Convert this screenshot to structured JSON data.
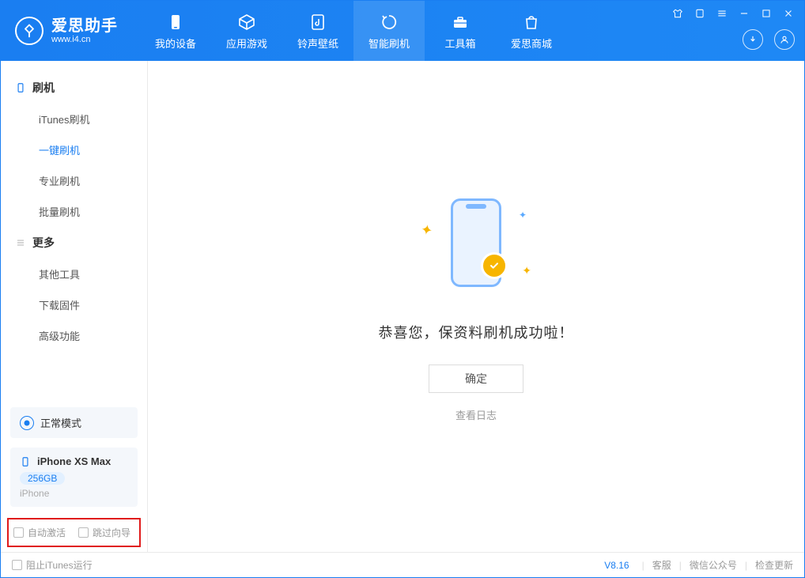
{
  "app": {
    "title": "爱思助手",
    "subtitle": "www.i4.cn"
  },
  "nav": {
    "items": [
      {
        "label": "我的设备"
      },
      {
        "label": "应用游戏"
      },
      {
        "label": "铃声壁纸"
      },
      {
        "label": "智能刷机"
      },
      {
        "label": "工具箱"
      },
      {
        "label": "爱思商城"
      }
    ]
  },
  "sidebar": {
    "section_flash": "刷机",
    "items_flash": [
      {
        "label": "iTunes刷机"
      },
      {
        "label": "一键刷机"
      },
      {
        "label": "专业刷机"
      },
      {
        "label": "批量刷机"
      }
    ],
    "section_more": "更多",
    "items_more": [
      {
        "label": "其他工具"
      },
      {
        "label": "下载固件"
      },
      {
        "label": "高级功能"
      }
    ]
  },
  "mode": {
    "label": "正常模式"
  },
  "device": {
    "name": "iPhone XS Max",
    "capacity": "256GB",
    "type": "iPhone"
  },
  "options": {
    "auto_activate": "自动激活",
    "skip_guide": "跳过向导"
  },
  "main": {
    "success_msg": "恭喜您，保资料刷机成功啦！",
    "ok": "确定",
    "view_log": "查看日志"
  },
  "footer": {
    "block_itunes": "阻止iTunes运行",
    "version": "V8.16",
    "links": {
      "support": "客服",
      "wechat": "微信公众号",
      "update": "检查更新"
    }
  }
}
